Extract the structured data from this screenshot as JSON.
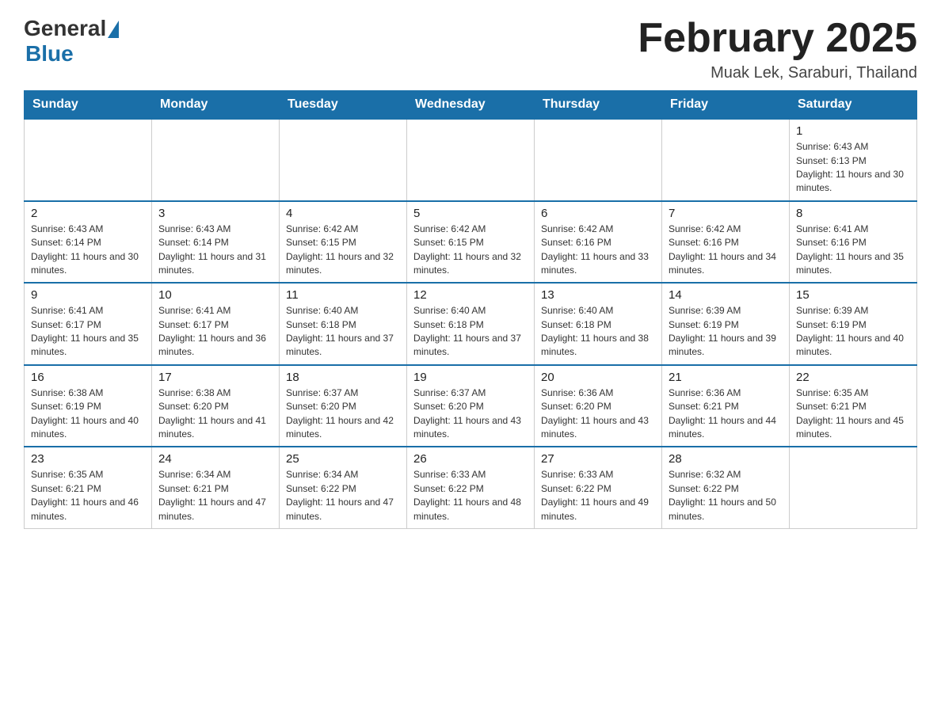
{
  "header": {
    "logo_general": "General",
    "logo_blue": "Blue",
    "month_title": "February 2025",
    "subtitle": "Muak Lek, Saraburi, Thailand"
  },
  "days_of_week": [
    "Sunday",
    "Monday",
    "Tuesday",
    "Wednesday",
    "Thursday",
    "Friday",
    "Saturday"
  ],
  "weeks": [
    [
      {
        "day": "",
        "info": ""
      },
      {
        "day": "",
        "info": ""
      },
      {
        "day": "",
        "info": ""
      },
      {
        "day": "",
        "info": ""
      },
      {
        "day": "",
        "info": ""
      },
      {
        "day": "",
        "info": ""
      },
      {
        "day": "1",
        "info": "Sunrise: 6:43 AM\nSunset: 6:13 PM\nDaylight: 11 hours and 30 minutes."
      }
    ],
    [
      {
        "day": "2",
        "info": "Sunrise: 6:43 AM\nSunset: 6:14 PM\nDaylight: 11 hours and 30 minutes."
      },
      {
        "day": "3",
        "info": "Sunrise: 6:43 AM\nSunset: 6:14 PM\nDaylight: 11 hours and 31 minutes."
      },
      {
        "day": "4",
        "info": "Sunrise: 6:42 AM\nSunset: 6:15 PM\nDaylight: 11 hours and 32 minutes."
      },
      {
        "day": "5",
        "info": "Sunrise: 6:42 AM\nSunset: 6:15 PM\nDaylight: 11 hours and 32 minutes."
      },
      {
        "day": "6",
        "info": "Sunrise: 6:42 AM\nSunset: 6:16 PM\nDaylight: 11 hours and 33 minutes."
      },
      {
        "day": "7",
        "info": "Sunrise: 6:42 AM\nSunset: 6:16 PM\nDaylight: 11 hours and 34 minutes."
      },
      {
        "day": "8",
        "info": "Sunrise: 6:41 AM\nSunset: 6:16 PM\nDaylight: 11 hours and 35 minutes."
      }
    ],
    [
      {
        "day": "9",
        "info": "Sunrise: 6:41 AM\nSunset: 6:17 PM\nDaylight: 11 hours and 35 minutes."
      },
      {
        "day": "10",
        "info": "Sunrise: 6:41 AM\nSunset: 6:17 PM\nDaylight: 11 hours and 36 minutes."
      },
      {
        "day": "11",
        "info": "Sunrise: 6:40 AM\nSunset: 6:18 PM\nDaylight: 11 hours and 37 minutes."
      },
      {
        "day": "12",
        "info": "Sunrise: 6:40 AM\nSunset: 6:18 PM\nDaylight: 11 hours and 37 minutes."
      },
      {
        "day": "13",
        "info": "Sunrise: 6:40 AM\nSunset: 6:18 PM\nDaylight: 11 hours and 38 minutes."
      },
      {
        "day": "14",
        "info": "Sunrise: 6:39 AM\nSunset: 6:19 PM\nDaylight: 11 hours and 39 minutes."
      },
      {
        "day": "15",
        "info": "Sunrise: 6:39 AM\nSunset: 6:19 PM\nDaylight: 11 hours and 40 minutes."
      }
    ],
    [
      {
        "day": "16",
        "info": "Sunrise: 6:38 AM\nSunset: 6:19 PM\nDaylight: 11 hours and 40 minutes."
      },
      {
        "day": "17",
        "info": "Sunrise: 6:38 AM\nSunset: 6:20 PM\nDaylight: 11 hours and 41 minutes."
      },
      {
        "day": "18",
        "info": "Sunrise: 6:37 AM\nSunset: 6:20 PM\nDaylight: 11 hours and 42 minutes."
      },
      {
        "day": "19",
        "info": "Sunrise: 6:37 AM\nSunset: 6:20 PM\nDaylight: 11 hours and 43 minutes."
      },
      {
        "day": "20",
        "info": "Sunrise: 6:36 AM\nSunset: 6:20 PM\nDaylight: 11 hours and 43 minutes."
      },
      {
        "day": "21",
        "info": "Sunrise: 6:36 AM\nSunset: 6:21 PM\nDaylight: 11 hours and 44 minutes."
      },
      {
        "day": "22",
        "info": "Sunrise: 6:35 AM\nSunset: 6:21 PM\nDaylight: 11 hours and 45 minutes."
      }
    ],
    [
      {
        "day": "23",
        "info": "Sunrise: 6:35 AM\nSunset: 6:21 PM\nDaylight: 11 hours and 46 minutes."
      },
      {
        "day": "24",
        "info": "Sunrise: 6:34 AM\nSunset: 6:21 PM\nDaylight: 11 hours and 47 minutes."
      },
      {
        "day": "25",
        "info": "Sunrise: 6:34 AM\nSunset: 6:22 PM\nDaylight: 11 hours and 47 minutes."
      },
      {
        "day": "26",
        "info": "Sunrise: 6:33 AM\nSunset: 6:22 PM\nDaylight: 11 hours and 48 minutes."
      },
      {
        "day": "27",
        "info": "Sunrise: 6:33 AM\nSunset: 6:22 PM\nDaylight: 11 hours and 49 minutes."
      },
      {
        "day": "28",
        "info": "Sunrise: 6:32 AM\nSunset: 6:22 PM\nDaylight: 11 hours and 50 minutes."
      },
      {
        "day": "",
        "info": ""
      }
    ]
  ]
}
